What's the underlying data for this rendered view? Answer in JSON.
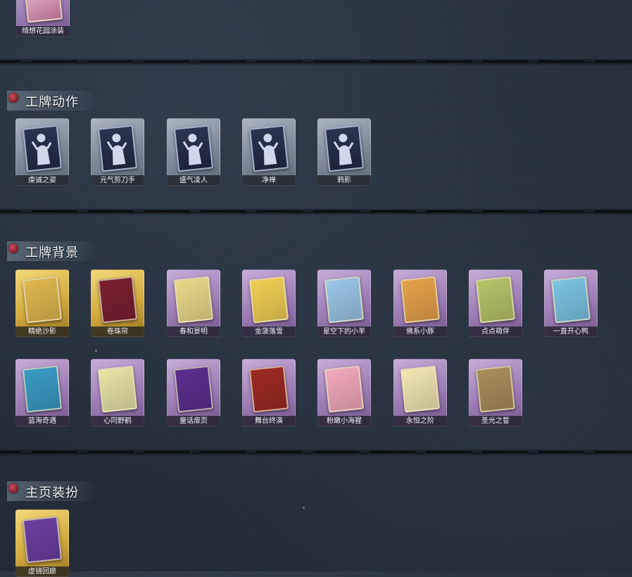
{
  "sections": [
    {
      "title": "工牌动作"
    },
    {
      "title": "工牌背景"
    },
    {
      "title": "主页装扮"
    }
  ],
  "top_card": {
    "label": "绮想花园涂装"
  },
  "badge_actions": [
    {
      "label": "虔诚之姿"
    },
    {
      "label": "元气剪刀手"
    },
    {
      "label": "盛气凌人"
    },
    {
      "label": "净禅"
    },
    {
      "label": "鸦影"
    }
  ],
  "badge_backgrounds_row1": [
    {
      "label": "精绝沙影",
      "tier": "gold",
      "art": "#e0b84f"
    },
    {
      "label": "卷珠帘",
      "tier": "gold",
      "art": "#7a2030"
    },
    {
      "label": "春和景明",
      "tier": "purple",
      "art": "#e8d98a"
    },
    {
      "label": "金菠落雪",
      "tier": "purple",
      "art": "#f1cf55"
    },
    {
      "label": "星空下的小羊",
      "tier": "purple",
      "art": "#9cc6e8"
    },
    {
      "label": "佛系小豚",
      "tier": "purple",
      "art": "#e6a24a"
    },
    {
      "label": "点点萌伴",
      "tier": "purple",
      "art": "#b7c46a"
    },
    {
      "label": "一直开心鸭",
      "tier": "purple",
      "art": "#7cc4e4"
    }
  ],
  "badge_backgrounds_row2": [
    {
      "label": "蓝海奇遇",
      "tier": "purple",
      "art": "#3a9bc4"
    },
    {
      "label": "心同野鹤",
      "tier": "purple",
      "art": "#e9e3a6"
    },
    {
      "label": "童话扉页",
      "tier": "purple",
      "art": "#5b2f8e"
    },
    {
      "label": "舞台终演",
      "tier": "purple",
      "art": "#9c2a24"
    },
    {
      "label": "粉嫩小海猩",
      "tier": "purple",
      "art": "#f2a9bd"
    },
    {
      "label": "永恒之阶",
      "tier": "purple",
      "art": "#f2e6b2"
    },
    {
      "label": "圣光之誓",
      "tier": "purple",
      "art": "#a88e5a"
    }
  ],
  "home_decor": [
    {
      "label": "虚镜回廊",
      "tier": "gold",
      "art": "#6b3fa0"
    }
  ]
}
